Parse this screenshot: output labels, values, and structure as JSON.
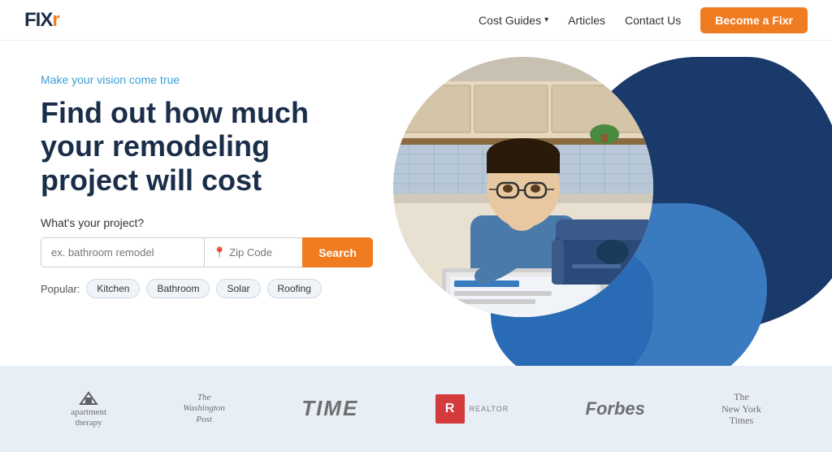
{
  "brand": {
    "logo_text": "FIXR",
    "logo_accent": "r"
  },
  "nav": {
    "cost_guides": "Cost Guides",
    "articles": "Articles",
    "contact_us": "Contact Us",
    "become_fixr": "Become a Fixr",
    "dropdown_arrow": "▾"
  },
  "hero": {
    "tagline": "Make your vision come true",
    "heading_line1": "Find out how much",
    "heading_line2": "your remodeling",
    "heading_line3": "project will cost",
    "question": "What's your project?",
    "search_placeholder": "ex. bathroom remodel",
    "zip_placeholder": "Zip Code",
    "search_button": "Search"
  },
  "popular": {
    "label": "Popular:",
    "tags": [
      "Kitchen",
      "Bathroom",
      "Solar",
      "Roofing"
    ]
  },
  "brands": [
    {
      "id": "apartment-therapy",
      "label": "apartment\ntherapy",
      "style": "apt"
    },
    {
      "id": "washington-post",
      "label": "The\nWashington\nPost",
      "style": "wapo"
    },
    {
      "id": "time",
      "label": "TIME",
      "style": "time"
    },
    {
      "id": "realtor",
      "label": "R",
      "sub": "REALTOR",
      "style": "realtor"
    },
    {
      "id": "forbes",
      "label": "Forbes",
      "style": "forbes"
    },
    {
      "id": "nyt",
      "label": "The\nNew York\nTimes",
      "style": "nyt"
    }
  ],
  "colors": {
    "accent_orange": "#f07c22",
    "accent_blue": "#3a9ed4",
    "dark_navy": "#1a2e4a",
    "blob_dark": "#1a3a6b",
    "blob_mid": "#3a7abf",
    "brands_bg": "#e8eef5"
  }
}
